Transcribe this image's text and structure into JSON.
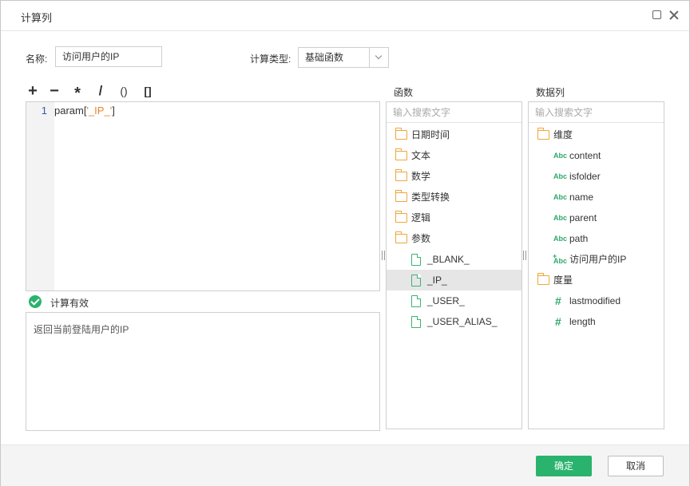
{
  "window": {
    "title": "计算列"
  },
  "form": {
    "name_label": "名称:",
    "name_value": "访问用户的IP",
    "type_label": "计算类型:",
    "type_value": "基础函数"
  },
  "operators": [
    "+",
    "−",
    "*",
    "/",
    "()",
    "[]"
  ],
  "editor": {
    "line_number": "1",
    "code_prefix": "param[",
    "code_string": "'_IP_'",
    "code_suffix": "]"
  },
  "status": {
    "text": "计算有效",
    "color": "#29b36d"
  },
  "description": "返回当前登陆用户的IP",
  "functions": {
    "title": "函数",
    "search_placeholder": "输入搜索文字",
    "folders": [
      "日期时间",
      "文本",
      "数学",
      "类型转换",
      "逻辑",
      "参数"
    ],
    "params": [
      "_BLANK_",
      "_IP_",
      "_USER_",
      "_USER_ALIAS_"
    ],
    "selected": "_IP_"
  },
  "columns": {
    "title": "数据列",
    "search_placeholder": "输入搜索文字",
    "dimension_label": "维度",
    "dimension_items": [
      "content",
      "isfolder",
      "name",
      "parent",
      "path",
      "访问用户的IP"
    ],
    "measure_label": "度量",
    "measure_items": [
      "lastmodified",
      "length"
    ],
    "abc_icon_text": "Abc",
    "hash_icon_text": "#"
  },
  "footer": {
    "ok_label": "确定",
    "cancel_label": "取消"
  },
  "colors": {
    "accent": "#29b36d",
    "folder": "#f0a63a",
    "string": "#e8842b"
  }
}
